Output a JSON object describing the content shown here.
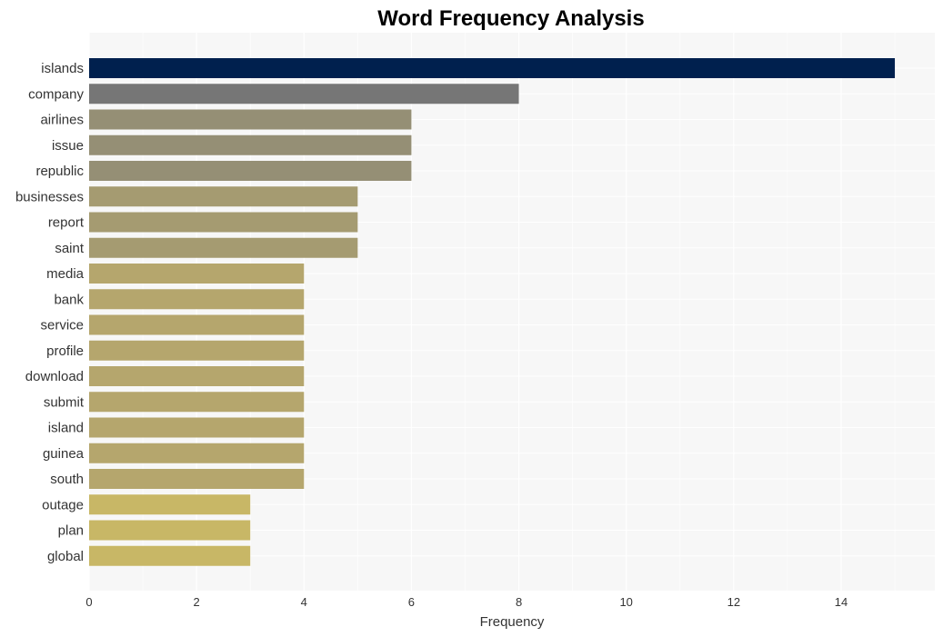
{
  "chart_data": {
    "type": "bar",
    "orientation": "horizontal",
    "title": "Word Frequency Analysis",
    "xlabel": "Frequency",
    "ylabel": "",
    "xlim": [
      0,
      15.7
    ],
    "xticks": [
      0,
      2,
      4,
      6,
      8,
      10,
      12,
      14
    ],
    "grid": true,
    "legend": "none",
    "categories": [
      "islands",
      "company",
      "airlines",
      "issue",
      "republic",
      "businesses",
      "report",
      "saint",
      "media",
      "bank",
      "service",
      "profile",
      "download",
      "submit",
      "island",
      "guinea",
      "south",
      "outage",
      "plan",
      "global"
    ],
    "values": [
      15,
      8,
      6,
      6,
      6,
      5,
      5,
      5,
      4,
      4,
      4,
      4,
      4,
      4,
      4,
      4,
      4,
      3,
      3,
      3
    ],
    "colors": [
      "#00204e",
      "#767676",
      "#958f75",
      "#958f75",
      "#958f75",
      "#a59b71",
      "#a59b71",
      "#a59b71",
      "#b5a66d",
      "#b5a66d",
      "#b5a66d",
      "#b5a66d",
      "#b5a66d",
      "#b5a66d",
      "#b5a66d",
      "#b5a66d",
      "#b5a66d",
      "#c8b766",
      "#c8b766",
      "#c8b766"
    ],
    "background_color": "#f7f7f7",
    "grid_color": "#ffffff"
  }
}
